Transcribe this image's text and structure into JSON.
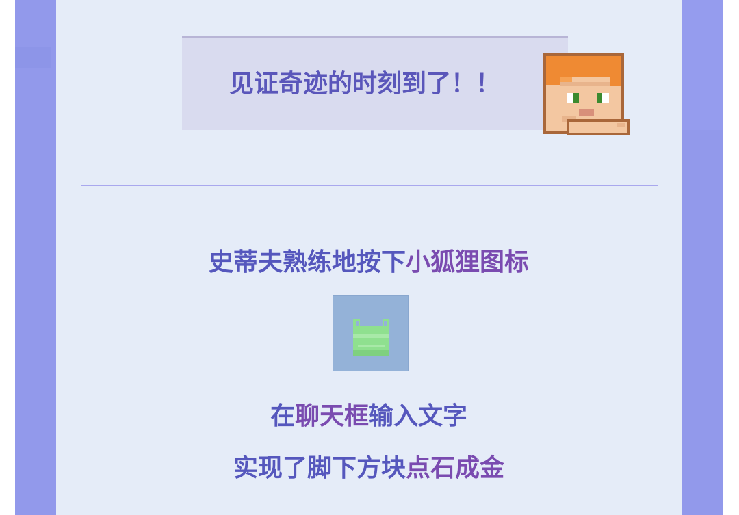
{
  "bubble": {
    "text": "见证奇迹的时刻到了！！"
  },
  "avatar": {
    "icon": "alex-pixel-head-icon"
  },
  "step1": {
    "text_a": "史蒂夫熟练地按下",
    "text_b": "小狐狸图标"
  },
  "fox_icon": {
    "icon": "pixel-fox-icon"
  },
  "step2": {
    "text_a": "在",
    "text_b": "聊天框",
    "text_c": "输入文字"
  },
  "step3": {
    "text_a": "实现了脚下方块",
    "text_b": "点石成金"
  },
  "colors": {
    "frame": "#9299eb",
    "panel": "#e5ecf8",
    "bubble": "#d9dbef",
    "text_blue": "#5557bd",
    "text_purple": "#7a4bb0",
    "fox_tile": "#94b2d8",
    "fox_green": "#8fe08f"
  }
}
